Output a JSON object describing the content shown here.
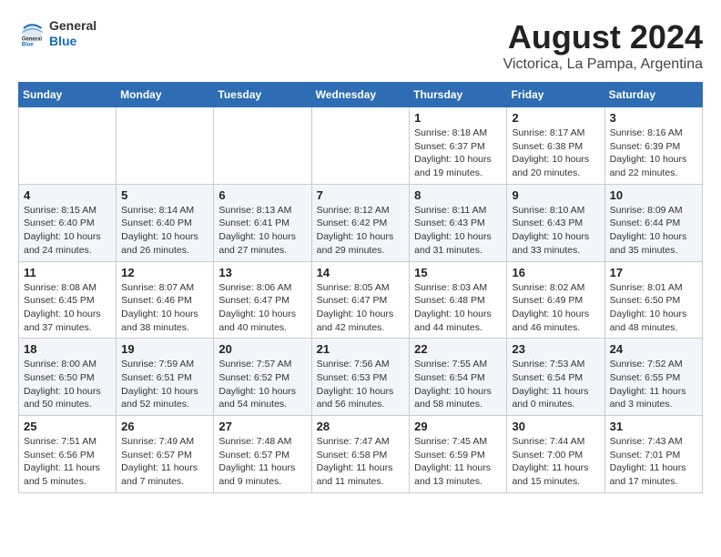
{
  "header": {
    "logo": {
      "general": "General",
      "blue": "Blue"
    },
    "title": "August 2024",
    "location": "Victorica, La Pampa, Argentina"
  },
  "calendar": {
    "days_of_week": [
      "Sunday",
      "Monday",
      "Tuesday",
      "Wednesday",
      "Thursday",
      "Friday",
      "Saturday"
    ],
    "weeks": [
      [
        {
          "day": "",
          "info": ""
        },
        {
          "day": "",
          "info": ""
        },
        {
          "day": "",
          "info": ""
        },
        {
          "day": "",
          "info": ""
        },
        {
          "day": "1",
          "info": "Sunrise: 8:18 AM\nSunset: 6:37 PM\nDaylight: 10 hours\nand 19 minutes."
        },
        {
          "day": "2",
          "info": "Sunrise: 8:17 AM\nSunset: 6:38 PM\nDaylight: 10 hours\nand 20 minutes."
        },
        {
          "day": "3",
          "info": "Sunrise: 8:16 AM\nSunset: 6:39 PM\nDaylight: 10 hours\nand 22 minutes."
        }
      ],
      [
        {
          "day": "4",
          "info": "Sunrise: 8:15 AM\nSunset: 6:40 PM\nDaylight: 10 hours\nand 24 minutes."
        },
        {
          "day": "5",
          "info": "Sunrise: 8:14 AM\nSunset: 6:40 PM\nDaylight: 10 hours\nand 26 minutes."
        },
        {
          "day": "6",
          "info": "Sunrise: 8:13 AM\nSunset: 6:41 PM\nDaylight: 10 hours\nand 27 minutes."
        },
        {
          "day": "7",
          "info": "Sunrise: 8:12 AM\nSunset: 6:42 PM\nDaylight: 10 hours\nand 29 minutes."
        },
        {
          "day": "8",
          "info": "Sunrise: 8:11 AM\nSunset: 6:43 PM\nDaylight: 10 hours\nand 31 minutes."
        },
        {
          "day": "9",
          "info": "Sunrise: 8:10 AM\nSunset: 6:43 PM\nDaylight: 10 hours\nand 33 minutes."
        },
        {
          "day": "10",
          "info": "Sunrise: 8:09 AM\nSunset: 6:44 PM\nDaylight: 10 hours\nand 35 minutes."
        }
      ],
      [
        {
          "day": "11",
          "info": "Sunrise: 8:08 AM\nSunset: 6:45 PM\nDaylight: 10 hours\nand 37 minutes."
        },
        {
          "day": "12",
          "info": "Sunrise: 8:07 AM\nSunset: 6:46 PM\nDaylight: 10 hours\nand 38 minutes."
        },
        {
          "day": "13",
          "info": "Sunrise: 8:06 AM\nSunset: 6:47 PM\nDaylight: 10 hours\nand 40 minutes."
        },
        {
          "day": "14",
          "info": "Sunrise: 8:05 AM\nSunset: 6:47 PM\nDaylight: 10 hours\nand 42 minutes."
        },
        {
          "day": "15",
          "info": "Sunrise: 8:03 AM\nSunset: 6:48 PM\nDaylight: 10 hours\nand 44 minutes."
        },
        {
          "day": "16",
          "info": "Sunrise: 8:02 AM\nSunset: 6:49 PM\nDaylight: 10 hours\nand 46 minutes."
        },
        {
          "day": "17",
          "info": "Sunrise: 8:01 AM\nSunset: 6:50 PM\nDaylight: 10 hours\nand 48 minutes."
        }
      ],
      [
        {
          "day": "18",
          "info": "Sunrise: 8:00 AM\nSunset: 6:50 PM\nDaylight: 10 hours\nand 50 minutes."
        },
        {
          "day": "19",
          "info": "Sunrise: 7:59 AM\nSunset: 6:51 PM\nDaylight: 10 hours\nand 52 minutes."
        },
        {
          "day": "20",
          "info": "Sunrise: 7:57 AM\nSunset: 6:52 PM\nDaylight: 10 hours\nand 54 minutes."
        },
        {
          "day": "21",
          "info": "Sunrise: 7:56 AM\nSunset: 6:53 PM\nDaylight: 10 hours\nand 56 minutes."
        },
        {
          "day": "22",
          "info": "Sunrise: 7:55 AM\nSunset: 6:54 PM\nDaylight: 10 hours\nand 58 minutes."
        },
        {
          "day": "23",
          "info": "Sunrise: 7:53 AM\nSunset: 6:54 PM\nDaylight: 11 hours\nand 0 minutes."
        },
        {
          "day": "24",
          "info": "Sunrise: 7:52 AM\nSunset: 6:55 PM\nDaylight: 11 hours\nand 3 minutes."
        }
      ],
      [
        {
          "day": "25",
          "info": "Sunrise: 7:51 AM\nSunset: 6:56 PM\nDaylight: 11 hours\nand 5 minutes."
        },
        {
          "day": "26",
          "info": "Sunrise: 7:49 AM\nSunset: 6:57 PM\nDaylight: 11 hours\nand 7 minutes."
        },
        {
          "day": "27",
          "info": "Sunrise: 7:48 AM\nSunset: 6:57 PM\nDaylight: 11 hours\nand 9 minutes."
        },
        {
          "day": "28",
          "info": "Sunrise: 7:47 AM\nSunset: 6:58 PM\nDaylight: 11 hours\nand 11 minutes."
        },
        {
          "day": "29",
          "info": "Sunrise: 7:45 AM\nSunset: 6:59 PM\nDaylight: 11 hours\nand 13 minutes."
        },
        {
          "day": "30",
          "info": "Sunrise: 7:44 AM\nSunset: 7:00 PM\nDaylight: 11 hours\nand 15 minutes."
        },
        {
          "day": "31",
          "info": "Sunrise: 7:43 AM\nSunset: 7:01 PM\nDaylight: 11 hours\nand 17 minutes."
        }
      ]
    ]
  }
}
